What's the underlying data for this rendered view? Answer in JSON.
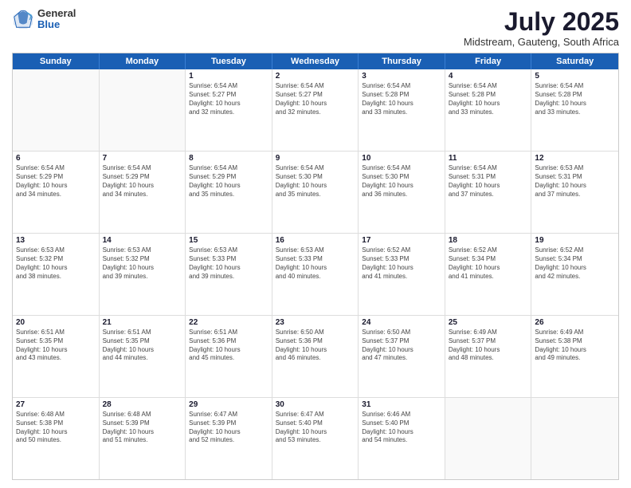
{
  "logo": {
    "general": "General",
    "blue": "Blue"
  },
  "title": "July 2025",
  "subtitle": "Midstream, Gauteng, South Africa",
  "header_days": [
    "Sunday",
    "Monday",
    "Tuesday",
    "Wednesday",
    "Thursday",
    "Friday",
    "Saturday"
  ],
  "weeks": [
    [
      {
        "day": "",
        "text": ""
      },
      {
        "day": "",
        "text": ""
      },
      {
        "day": "1",
        "text": "Sunrise: 6:54 AM\nSunset: 5:27 PM\nDaylight: 10 hours\nand 32 minutes."
      },
      {
        "day": "2",
        "text": "Sunrise: 6:54 AM\nSunset: 5:27 PM\nDaylight: 10 hours\nand 32 minutes."
      },
      {
        "day": "3",
        "text": "Sunrise: 6:54 AM\nSunset: 5:28 PM\nDaylight: 10 hours\nand 33 minutes."
      },
      {
        "day": "4",
        "text": "Sunrise: 6:54 AM\nSunset: 5:28 PM\nDaylight: 10 hours\nand 33 minutes."
      },
      {
        "day": "5",
        "text": "Sunrise: 6:54 AM\nSunset: 5:28 PM\nDaylight: 10 hours\nand 33 minutes."
      }
    ],
    [
      {
        "day": "6",
        "text": "Sunrise: 6:54 AM\nSunset: 5:29 PM\nDaylight: 10 hours\nand 34 minutes."
      },
      {
        "day": "7",
        "text": "Sunrise: 6:54 AM\nSunset: 5:29 PM\nDaylight: 10 hours\nand 34 minutes."
      },
      {
        "day": "8",
        "text": "Sunrise: 6:54 AM\nSunset: 5:29 PM\nDaylight: 10 hours\nand 35 minutes."
      },
      {
        "day": "9",
        "text": "Sunrise: 6:54 AM\nSunset: 5:30 PM\nDaylight: 10 hours\nand 35 minutes."
      },
      {
        "day": "10",
        "text": "Sunrise: 6:54 AM\nSunset: 5:30 PM\nDaylight: 10 hours\nand 36 minutes."
      },
      {
        "day": "11",
        "text": "Sunrise: 6:54 AM\nSunset: 5:31 PM\nDaylight: 10 hours\nand 37 minutes."
      },
      {
        "day": "12",
        "text": "Sunrise: 6:53 AM\nSunset: 5:31 PM\nDaylight: 10 hours\nand 37 minutes."
      }
    ],
    [
      {
        "day": "13",
        "text": "Sunrise: 6:53 AM\nSunset: 5:32 PM\nDaylight: 10 hours\nand 38 minutes."
      },
      {
        "day": "14",
        "text": "Sunrise: 6:53 AM\nSunset: 5:32 PM\nDaylight: 10 hours\nand 39 minutes."
      },
      {
        "day": "15",
        "text": "Sunrise: 6:53 AM\nSunset: 5:33 PM\nDaylight: 10 hours\nand 39 minutes."
      },
      {
        "day": "16",
        "text": "Sunrise: 6:53 AM\nSunset: 5:33 PM\nDaylight: 10 hours\nand 40 minutes."
      },
      {
        "day": "17",
        "text": "Sunrise: 6:52 AM\nSunset: 5:33 PM\nDaylight: 10 hours\nand 41 minutes."
      },
      {
        "day": "18",
        "text": "Sunrise: 6:52 AM\nSunset: 5:34 PM\nDaylight: 10 hours\nand 41 minutes."
      },
      {
        "day": "19",
        "text": "Sunrise: 6:52 AM\nSunset: 5:34 PM\nDaylight: 10 hours\nand 42 minutes."
      }
    ],
    [
      {
        "day": "20",
        "text": "Sunrise: 6:51 AM\nSunset: 5:35 PM\nDaylight: 10 hours\nand 43 minutes."
      },
      {
        "day": "21",
        "text": "Sunrise: 6:51 AM\nSunset: 5:35 PM\nDaylight: 10 hours\nand 44 minutes."
      },
      {
        "day": "22",
        "text": "Sunrise: 6:51 AM\nSunset: 5:36 PM\nDaylight: 10 hours\nand 45 minutes."
      },
      {
        "day": "23",
        "text": "Sunrise: 6:50 AM\nSunset: 5:36 PM\nDaylight: 10 hours\nand 46 minutes."
      },
      {
        "day": "24",
        "text": "Sunrise: 6:50 AM\nSunset: 5:37 PM\nDaylight: 10 hours\nand 47 minutes."
      },
      {
        "day": "25",
        "text": "Sunrise: 6:49 AM\nSunset: 5:37 PM\nDaylight: 10 hours\nand 48 minutes."
      },
      {
        "day": "26",
        "text": "Sunrise: 6:49 AM\nSunset: 5:38 PM\nDaylight: 10 hours\nand 49 minutes."
      }
    ],
    [
      {
        "day": "27",
        "text": "Sunrise: 6:48 AM\nSunset: 5:38 PM\nDaylight: 10 hours\nand 50 minutes."
      },
      {
        "day": "28",
        "text": "Sunrise: 6:48 AM\nSunset: 5:39 PM\nDaylight: 10 hours\nand 51 minutes."
      },
      {
        "day": "29",
        "text": "Sunrise: 6:47 AM\nSunset: 5:39 PM\nDaylight: 10 hours\nand 52 minutes."
      },
      {
        "day": "30",
        "text": "Sunrise: 6:47 AM\nSunset: 5:40 PM\nDaylight: 10 hours\nand 53 minutes."
      },
      {
        "day": "31",
        "text": "Sunrise: 6:46 AM\nSunset: 5:40 PM\nDaylight: 10 hours\nand 54 minutes."
      },
      {
        "day": "",
        "text": ""
      },
      {
        "day": "",
        "text": ""
      }
    ]
  ]
}
